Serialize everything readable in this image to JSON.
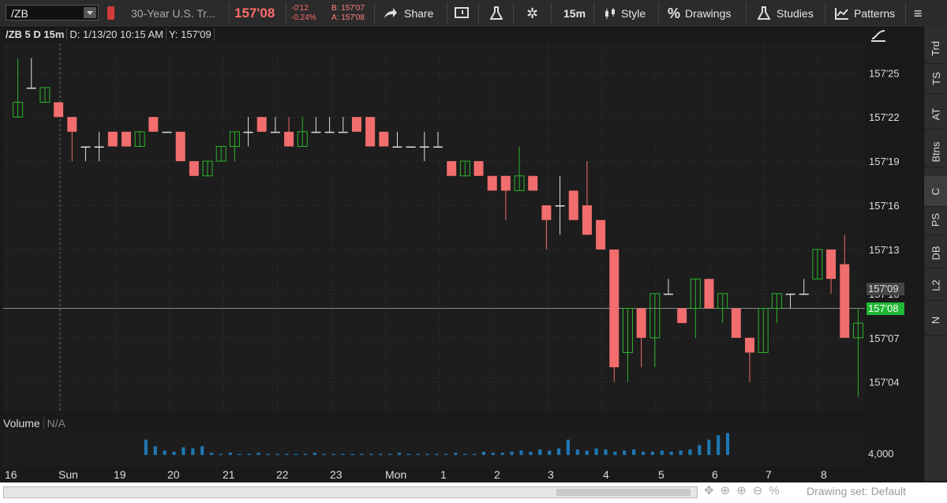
{
  "toolbar": {
    "symbol": "/ZB",
    "description": "30-Year U.S. Tr...",
    "last_price": "157'08",
    "net_change": "-0'12",
    "pct_change": "-0.24%",
    "bid": "B: 157'07",
    "ask": "A: 157'08",
    "share_label": "Share",
    "aggregation": "15m",
    "style_label": "Style",
    "drawings_label": "Drawings",
    "studies_label": "Studies",
    "patterns_label": "Patterns"
  },
  "chart_header": {
    "title": "/ZB 5 D 15m",
    "datetime": "D: 1/13/20 10:15 AM",
    "y_readout": "Y: 157'09"
  },
  "right_tabs": [
    "Trd",
    "TS",
    "AT",
    "Btns",
    "C",
    "PS",
    "DB",
    "L2",
    "N"
  ],
  "volume": {
    "label": "Volume",
    "value": "N/A",
    "scale_label": "4,000"
  },
  "price_labels": {
    "crosshair": "157'09",
    "last": "157'08"
  },
  "bottom": {
    "drawing_set": "Drawing set: Default"
  },
  "chart_data": {
    "type": "candlestick",
    "y_ticks": [
      "157'25",
      "157'22",
      "157'19",
      "157'16",
      "157'13",
      "157'10",
      "157'07",
      "157'04"
    ],
    "y_tick_values": [
      157.78125,
      157.6875,
      157.59375,
      157.5,
      157.40625,
      157.3125,
      157.21875,
      157.125
    ],
    "ylim": [
      157.0625,
      157.84375
    ],
    "crosshair_y": 157.28125,
    "x_labels": [
      "16",
      "Sun",
      "19",
      "20",
      "21",
      "22",
      "23",
      "Mon",
      "1",
      "2",
      "3",
      "4",
      "5",
      "6",
      "7",
      "8"
    ],
    "candles": [
      {
        "o": 157.6875,
        "c": 157.71875,
        "h": 157.8125,
        "l": 157.6875
      },
      {
        "o": 157.75,
        "c": 157.75,
        "h": 157.8125,
        "l": 157.75
      },
      {
        "o": 157.71875,
        "c": 157.75,
        "h": 157.75,
        "l": 157.71875
      },
      {
        "o": 157.71875,
        "c": 157.6875,
        "h": 157.71875,
        "l": 157.6875
      },
      {
        "o": 157.6875,
        "c": 157.65625,
        "h": 157.6875,
        "l": 157.59375
      },
      {
        "o": 157.625,
        "c": 157.625,
        "h": 157.625,
        "l": 157.59375
      },
      {
        "o": 157.625,
        "c": 157.625,
        "h": 157.65625,
        "l": 157.59375
      },
      {
        "o": 157.65625,
        "c": 157.625,
        "h": 157.65625,
        "l": 157.625
      },
      {
        "o": 157.65625,
        "c": 157.625,
        "h": 157.65625,
        "l": 157.625
      },
      {
        "o": 157.625,
        "c": 157.65625,
        "h": 157.65625,
        "l": 157.625
      },
      {
        "o": 157.6875,
        "c": 157.65625,
        "h": 157.6875,
        "l": 157.65625
      },
      {
        "o": 157.65625,
        "c": 157.65625,
        "h": 157.65625,
        "l": 157.65625
      },
      {
        "o": 157.65625,
        "c": 157.59375,
        "h": 157.65625,
        "l": 157.59375
      },
      {
        "o": 157.59375,
        "c": 157.5625,
        "h": 157.59375,
        "l": 157.5625
      },
      {
        "o": 157.5625,
        "c": 157.59375,
        "h": 157.59375,
        "l": 157.5625
      },
      {
        "o": 157.59375,
        "c": 157.625,
        "h": 157.625,
        "l": 157.59375
      },
      {
        "o": 157.625,
        "c": 157.65625,
        "h": 157.65625,
        "l": 157.59375
      },
      {
        "o": 157.65625,
        "c": 157.65625,
        "h": 157.6875,
        "l": 157.625
      },
      {
        "o": 157.6875,
        "c": 157.65625,
        "h": 157.6875,
        "l": 157.65625
      },
      {
        "o": 157.65625,
        "c": 157.65625,
        "h": 157.6875,
        "l": 157.65625
      },
      {
        "o": 157.65625,
        "c": 157.625,
        "h": 157.6875,
        "l": 157.625
      },
      {
        "o": 157.625,
        "c": 157.65625,
        "h": 157.6875,
        "l": 157.625
      },
      {
        "o": 157.65625,
        "c": 157.65625,
        "h": 157.6875,
        "l": 157.65625
      },
      {
        "o": 157.65625,
        "c": 157.65625,
        "h": 157.6875,
        "l": 157.65625
      },
      {
        "o": 157.65625,
        "c": 157.65625,
        "h": 157.6875,
        "l": 157.65625
      },
      {
        "o": 157.6875,
        "c": 157.65625,
        "h": 157.6875,
        "l": 157.65625
      },
      {
        "o": 157.6875,
        "c": 157.625,
        "h": 157.6875,
        "l": 157.625
      },
      {
        "o": 157.65625,
        "c": 157.625,
        "h": 157.65625,
        "l": 157.625
      },
      {
        "o": 157.625,
        "c": 157.625,
        "h": 157.65625,
        "l": 157.625
      },
      {
        "o": 157.625,
        "c": 157.625,
        "h": 157.625,
        "l": 157.625
      },
      {
        "o": 157.625,
        "c": 157.625,
        "h": 157.65625,
        "l": 157.59375
      },
      {
        "o": 157.625,
        "c": 157.625,
        "h": 157.65625,
        "l": 157.625
      },
      {
        "o": 157.59375,
        "c": 157.5625,
        "h": 157.59375,
        "l": 157.5625
      },
      {
        "o": 157.5625,
        "c": 157.59375,
        "h": 157.59375,
        "l": 157.5625
      },
      {
        "o": 157.59375,
        "c": 157.5625,
        "h": 157.59375,
        "l": 157.5625
      },
      {
        "o": 157.5625,
        "c": 157.53125,
        "h": 157.5625,
        "l": 157.53125
      },
      {
        "o": 157.5625,
        "c": 157.53125,
        "h": 157.5625,
        "l": 157.46875
      },
      {
        "o": 157.53125,
        "c": 157.5625,
        "h": 157.625,
        "l": 157.53125
      },
      {
        "o": 157.5625,
        "c": 157.53125,
        "h": 157.5625,
        "l": 157.53125
      },
      {
        "o": 157.5,
        "c": 157.46875,
        "h": 157.5,
        "l": 157.40625
      },
      {
        "o": 157.5,
        "c": 157.5,
        "h": 157.5625,
        "l": 157.4375
      },
      {
        "o": 157.53125,
        "c": 157.46875,
        "h": 157.53125,
        "l": 157.46875
      },
      {
        "o": 157.5,
        "c": 157.4375,
        "h": 157.59375,
        "l": 157.4375
      },
      {
        "o": 157.46875,
        "c": 157.40625,
        "h": 157.46875,
        "l": 157.40625
      },
      {
        "o": 157.40625,
        "c": 157.15625,
        "h": 157.40625,
        "l": 157.125
      },
      {
        "o": 157.1875,
        "c": 157.28125,
        "h": 157.28125,
        "l": 157.125
      },
      {
        "o": 157.28125,
        "c": 157.21875,
        "h": 157.28125,
        "l": 157.15625
      },
      {
        "o": 157.21875,
        "c": 157.3125,
        "h": 157.3125,
        "l": 157.15625
      },
      {
        "o": 157.3125,
        "c": 157.3125,
        "h": 157.34375,
        "l": 157.3125
      },
      {
        "o": 157.28125,
        "c": 157.25,
        "h": 157.28125,
        "l": 157.25
      },
      {
        "o": 157.28125,
        "c": 157.34375,
        "h": 157.34375,
        "l": 157.21875
      },
      {
        "o": 157.34375,
        "c": 157.28125,
        "h": 157.34375,
        "l": 157.28125
      },
      {
        "o": 157.28125,
        "c": 157.3125,
        "h": 157.3125,
        "l": 157.25
      },
      {
        "o": 157.28125,
        "c": 157.21875,
        "h": 157.28125,
        "l": 157.21875
      },
      {
        "o": 157.21875,
        "c": 157.1875,
        "h": 157.21875,
        "l": 157.125
      },
      {
        "o": 157.1875,
        "c": 157.28125,
        "h": 157.28125,
        "l": 157.1875
      },
      {
        "o": 157.28125,
        "c": 157.3125,
        "h": 157.3125,
        "l": 157.25
      },
      {
        "o": 157.3125,
        "c": 157.3125,
        "h": 157.3125,
        "l": 157.28125
      },
      {
        "o": 157.3125,
        "c": 157.3125,
        "h": 157.34375,
        "l": 157.3125
      },
      {
        "o": 157.34375,
        "c": 157.40625,
        "h": 157.40625,
        "l": 157.34375
      },
      {
        "o": 157.40625,
        "c": 157.34375,
        "h": 157.40625,
        "l": 157.3125
      },
      {
        "o": 157.375,
        "c": 157.21875,
        "h": 157.4375,
        "l": 157.21875
      },
      {
        "o": 157.21875,
        "c": 157.25,
        "h": 157.28125,
        "l": 157.09375
      }
    ],
    "volume_scale": 4000
  }
}
